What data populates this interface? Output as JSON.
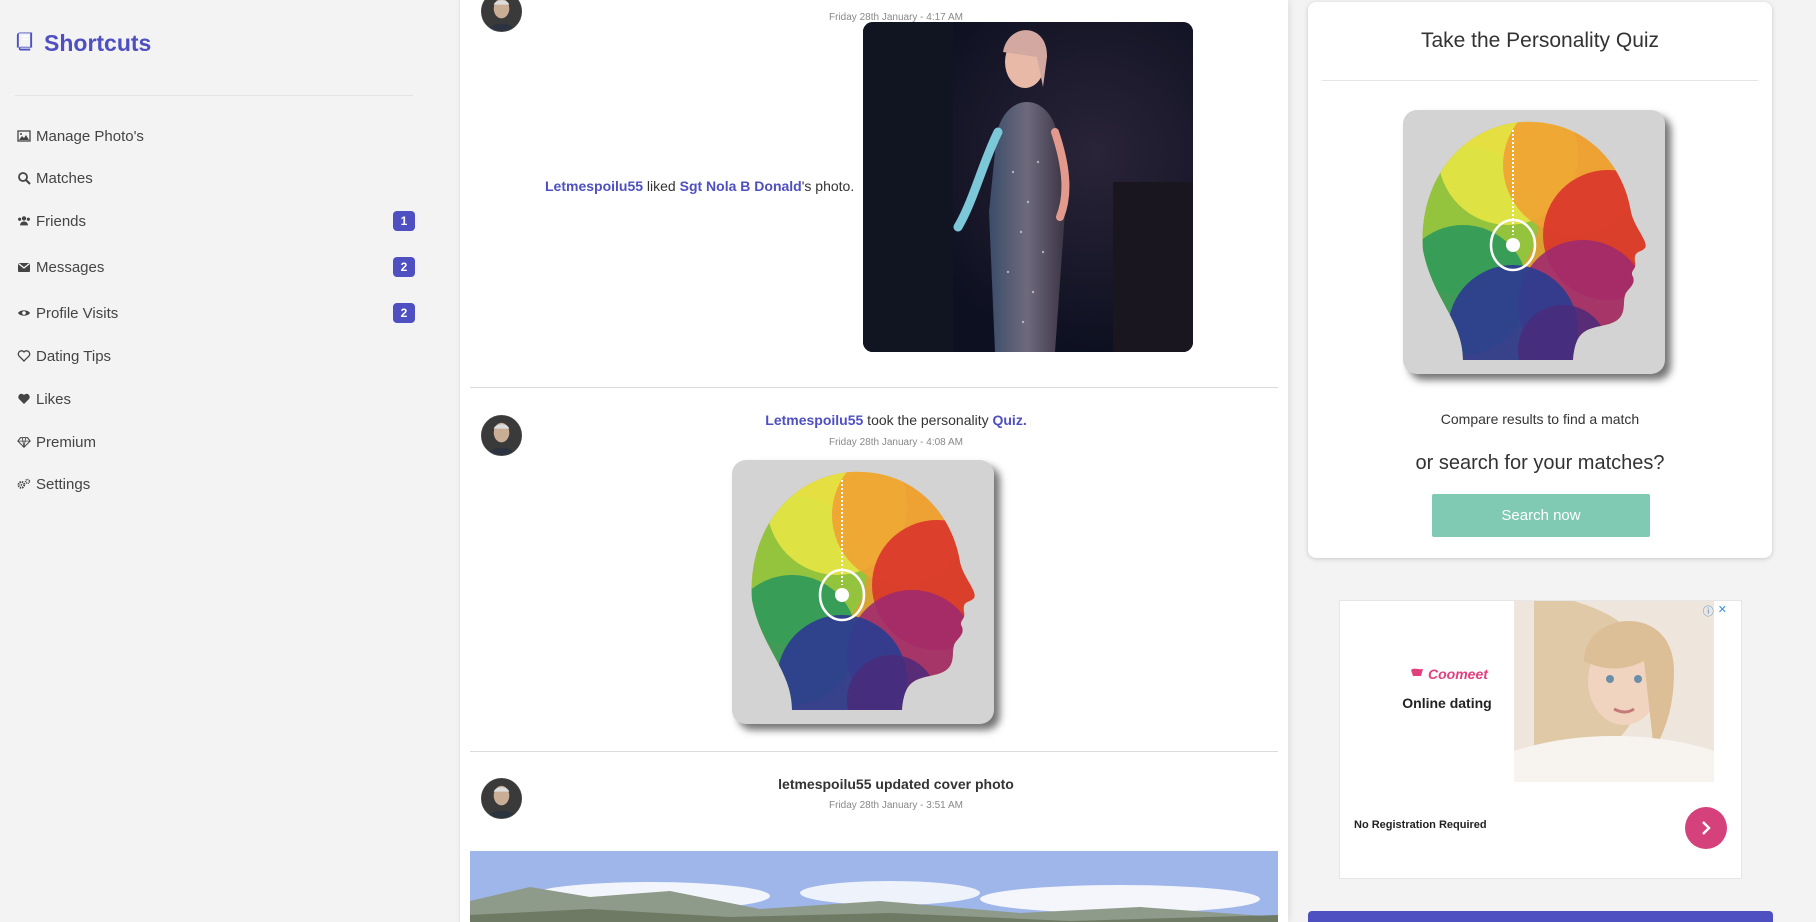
{
  "sidebar": {
    "brand": "Shortcuts",
    "items": [
      {
        "label": "Manage Photo's",
        "icon": "image-icon",
        "badge": null
      },
      {
        "label": "Matches",
        "icon": "search-icon",
        "badge": null
      },
      {
        "label": "Friends",
        "icon": "users-icon",
        "badge": "1"
      },
      {
        "label": "Messages",
        "icon": "envelope-icon",
        "badge": "2"
      },
      {
        "label": "Profile Visits",
        "icon": "eye-icon",
        "badge": "2"
      },
      {
        "label": "Dating Tips",
        "icon": "heart-outline-icon",
        "badge": null
      },
      {
        "label": "Likes",
        "icon": "heart-icon",
        "badge": null
      },
      {
        "label": "Premium",
        "icon": "diamond-icon",
        "badge": null
      },
      {
        "label": "Settings",
        "icon": "gears-icon",
        "badge": null
      }
    ]
  },
  "feed": {
    "posts": [
      {
        "time": "Friday 28th January - 4:17 AM",
        "user": "Letmespoilu55",
        "verb": " liked ",
        "target": "Sgt Nola B Donald",
        "suffix": "'s photo."
      },
      {
        "time": "Friday 28th January - 4:08 AM",
        "user": "Letmespoilu55",
        "verb": " took the personality ",
        "target": "Quiz."
      },
      {
        "time": "Friday 28th January - 3:51 AM",
        "text": "letmespoilu55 updated cover photo"
      }
    ]
  },
  "quiz_card": {
    "title": "Take the Personality Quiz",
    "subtitle": "Compare results to find a match",
    "or_text": "or search for your matches?",
    "button": "Search now"
  },
  "ad": {
    "brand": "Coomeet",
    "headline": "Online dating",
    "footer": "No Registration Required"
  },
  "colors": {
    "accent": "#4e4fc1",
    "button_teal": "#80c9b2",
    "ad_pink": "#d5427b"
  }
}
